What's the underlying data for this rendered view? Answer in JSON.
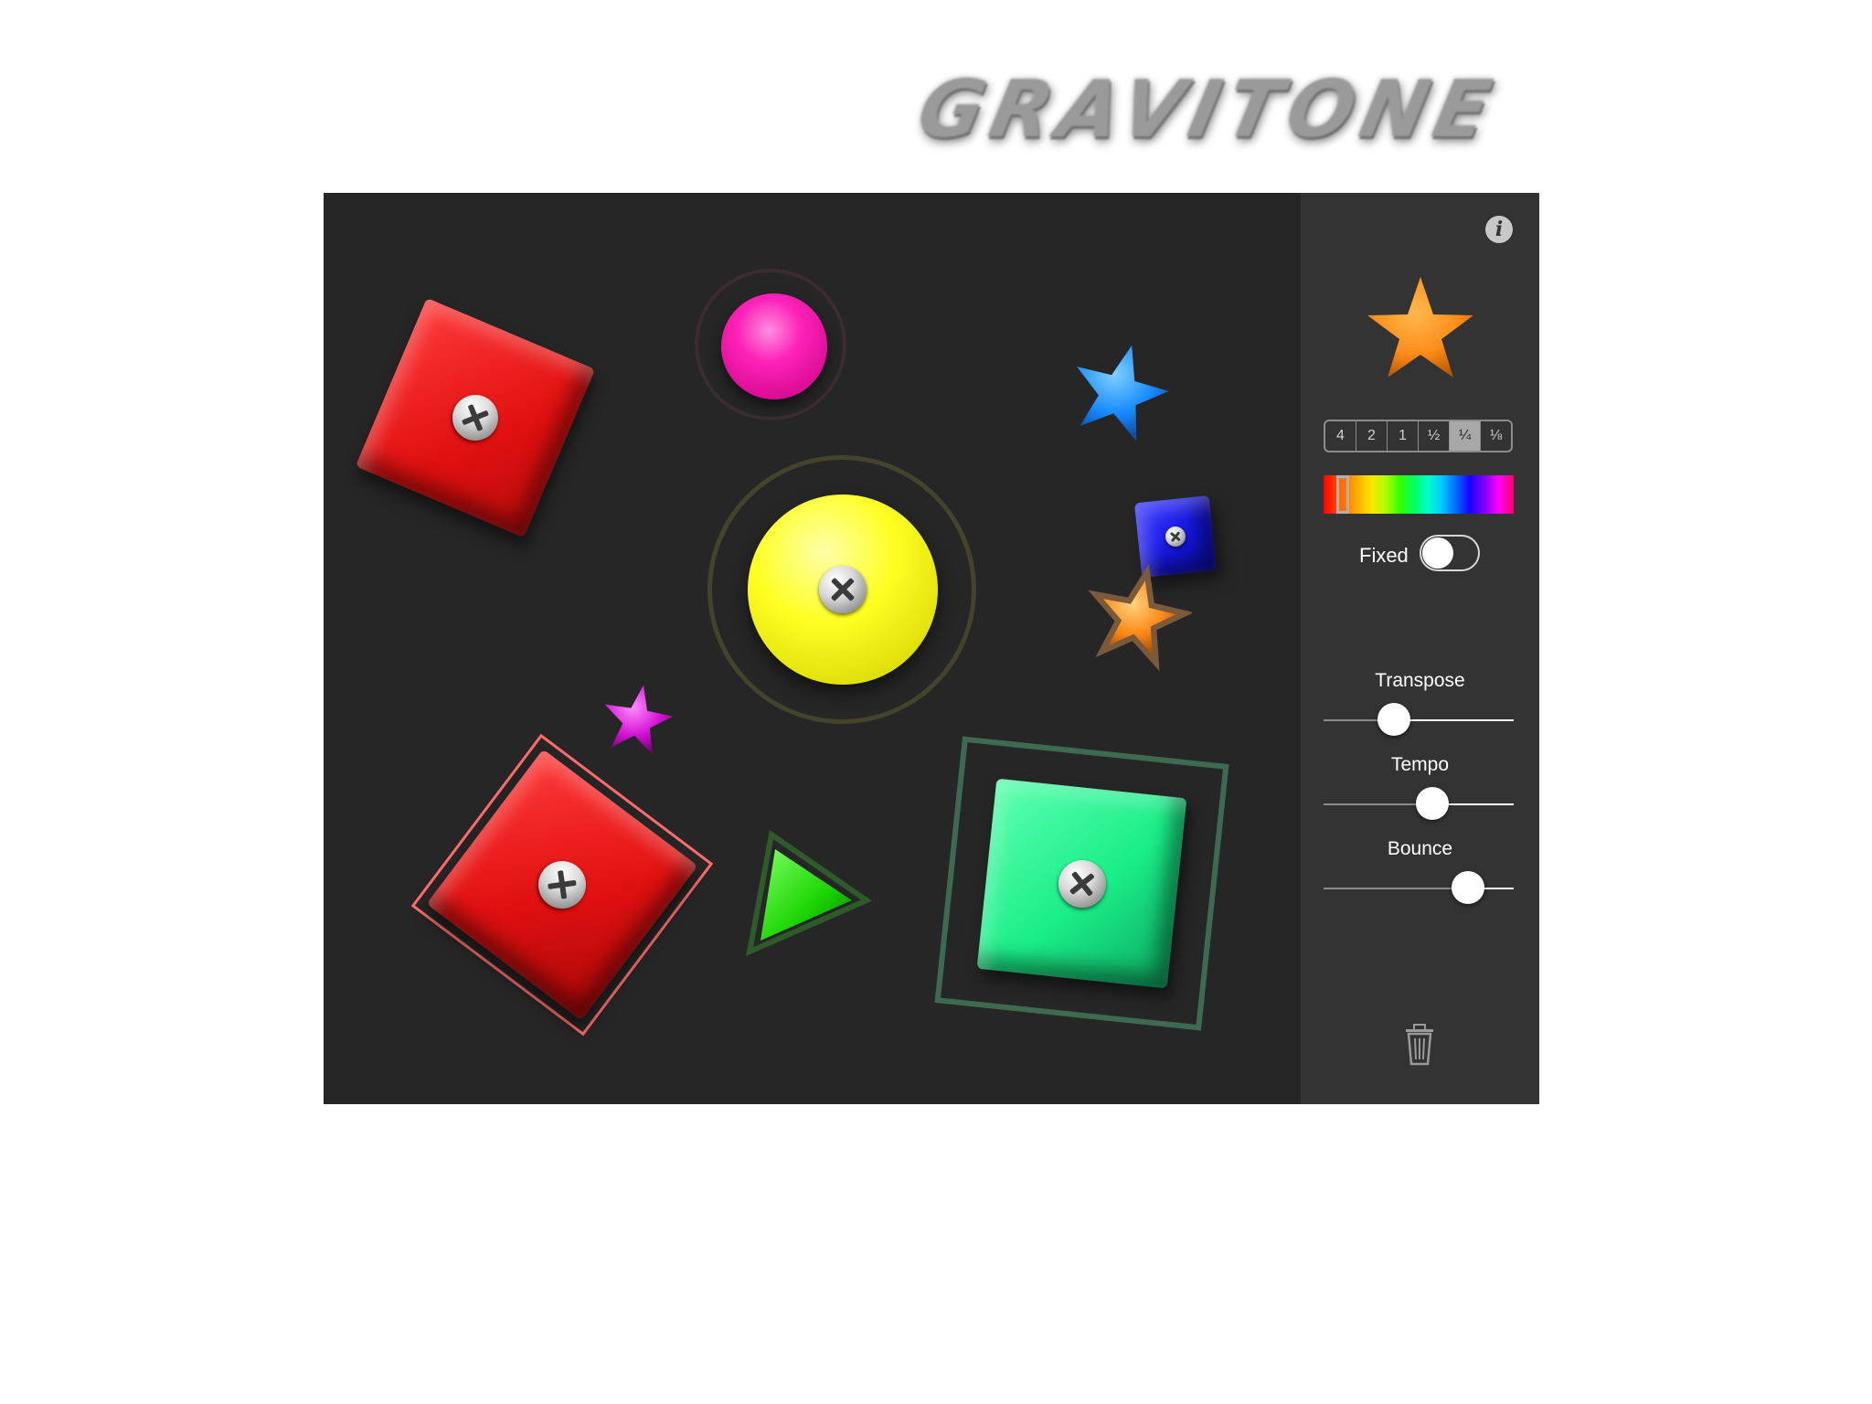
{
  "app": {
    "title": "GRAVITONE"
  },
  "panel": {
    "selected_shape_icon": "orange-star-icon",
    "info_icon": "info-icon",
    "note_lengths": [
      {
        "label": "4",
        "selected": false
      },
      {
        "label": "2",
        "selected": false
      },
      {
        "label": "1",
        "selected": false
      },
      {
        "label": "½",
        "selected": false
      },
      {
        "label": "¼",
        "selected": true
      },
      {
        "label": "⅛",
        "selected": false
      }
    ],
    "color_spectrum_icon": "color-spectrum-picker",
    "fixed": {
      "label": "Fixed",
      "on": false
    },
    "sliders": [
      {
        "label": "Transpose",
        "value": 0.37
      },
      {
        "label": "Tempo",
        "value": 0.57
      },
      {
        "label": "Bounce",
        "value": 0.76
      }
    ],
    "trash_icon": "trash-icon"
  },
  "colors": {
    "red": "#ff1a1a",
    "magenta": "#ff1aa8",
    "yellow": "#ffff00",
    "blue": "#1a1aff",
    "sky_blue": "#1a8cff",
    "orange": "#ff8c1a",
    "purple": "#cc00cc",
    "green": "#1aff00",
    "teal_green": "#1aee88"
  }
}
